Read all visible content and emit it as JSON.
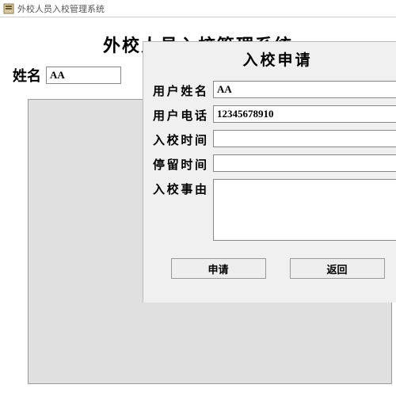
{
  "window": {
    "title": "外校人员入校管理系统"
  },
  "main": {
    "heading": "外校人员入校管理系统"
  },
  "left": {
    "name_label": "姓名",
    "name_value": "AA"
  },
  "dialog": {
    "title": "入校申请",
    "fields": {
      "username_label": "用户姓名",
      "username_value": "AA",
      "phone_label": "用户电话",
      "phone_value": "12345678910",
      "entry_time_label": "入校时间",
      "entry_time_value": "",
      "stay_time_label": "停留时间",
      "stay_time_value": "",
      "reason_label": "入校事由",
      "reason_value": ""
    },
    "buttons": {
      "apply": "申请",
      "back": "返回"
    }
  }
}
